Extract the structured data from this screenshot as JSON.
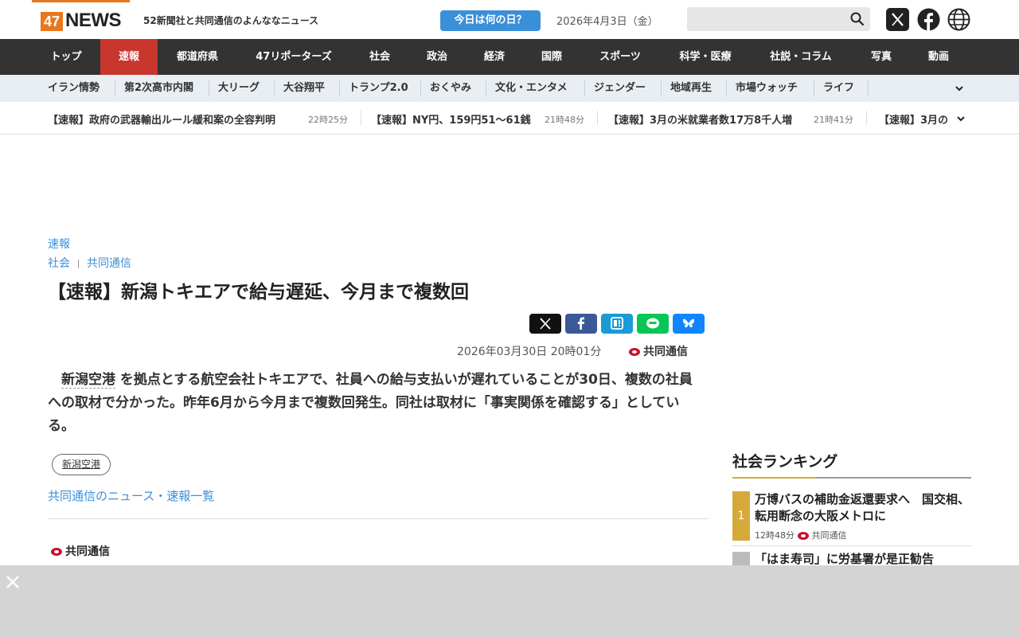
{
  "header": {
    "logo_num": "47",
    "logo_text": "NEWS",
    "tagline": "52新聞社と共同通信のよんななニュース",
    "today_button": "今日は何の日？",
    "date": "2026年4月3日（金）",
    "search_placeholder": ""
  },
  "main_nav": [
    "トップ",
    "速報",
    "都道府県",
    "47リポーターズ",
    "社会",
    "政治",
    "経済",
    "国際",
    "スポーツ",
    "科学・医療",
    "社説・コラム",
    "写真",
    "動画"
  ],
  "sub_nav": [
    "イラン情勢",
    "第2次高市内閣",
    "大リーグ",
    "大谷翔平",
    "トランプ2.0",
    "おくやみ",
    "文化・エンタメ",
    "ジェンダー",
    "地域再生",
    "市場ウォッチ",
    "ライフ"
  ],
  "ticker": [
    {
      "text": "【速報】政府の武器輸出ルール緩和案の全容判明",
      "time": "22時25分"
    },
    {
      "text": "【速報】NY円、159円51～61銭",
      "time": "21時48分"
    },
    {
      "text": "【速報】3月の米就業者数17万8千人増",
      "time": "21時41分"
    },
    {
      "text": "【速報】3月の",
      "time": ""
    }
  ],
  "article": {
    "category": "速報",
    "section": "社会",
    "source": "共同通信",
    "title": "【速報】新潟トキエアで給与遅延、今月まで複数回",
    "datetime": "2026年03月30日 20時01分",
    "meta_source": "共同通信",
    "body_link": "新潟空港",
    "body_rest": " を拠点とする航空会社トキエアで、社員への給与支払いが遅れていることが30日、複数の社員への取材で分かった。昨年6月から今月まで複数回発生。同社は取材に「事実関係を確認する」としている。",
    "tag": "新潟空港",
    "list_link": "共同通信のニュース・速報一覧",
    "footer_source": "共同通信"
  },
  "ranking": {
    "title": "社会ランキング",
    "items": [
      {
        "rank": "1",
        "text": "万博バスの補助金返還要求へ　国交相、転用断念の大阪メトロに",
        "time": "12時48分",
        "source": "共同通信"
      },
      {
        "rank": "",
        "text": "「はま寿司」に労基署が是正勧告",
        "time": "",
        "source": ""
      }
    ]
  },
  "colors": {
    "brand_orange": "#e8771e",
    "nav_dark": "#333333",
    "nav_active": "#c8362e",
    "link_blue": "#3a8fd9",
    "rank_gold": "#d6a93a"
  }
}
